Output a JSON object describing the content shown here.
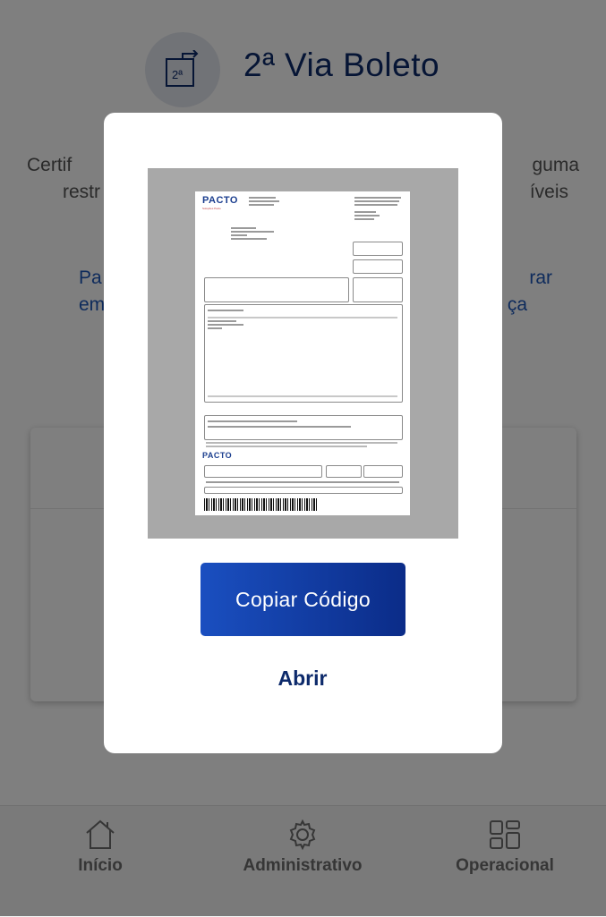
{
  "header": {
    "icon_badge": "2ª",
    "title": "2ª Via Boleto"
  },
  "description": {
    "line1_left": "Certif",
    "line1_right": "guma",
    "line2_left": "restr",
    "line2_right": "íveis"
  },
  "link": {
    "line1_left": "Pa",
    "line1_right": "rar",
    "line2_left": "em",
    "line2_right": "ça"
  },
  "modal": {
    "preview": {
      "logo": "PACTO",
      "logo_sub": "Soluções Pacto",
      "logo_bottom": "PACTO"
    },
    "copy_button": "Copiar Código",
    "open_link": "Abrir"
  },
  "tabbar": {
    "items": [
      {
        "label": "Início",
        "icon": "home-icon"
      },
      {
        "label": "Administrativo",
        "icon": "gear-icon"
      },
      {
        "label": "Operacional",
        "icon": "grid-icon"
      }
    ]
  },
  "colors": {
    "primary_dark": "#0d2a6b",
    "button_gradient_start": "#1a4fc0",
    "button_gradient_end": "#0b2c88",
    "link_blue": "#1d56b8",
    "overlay": "rgba(0,0,0,0.5)"
  }
}
